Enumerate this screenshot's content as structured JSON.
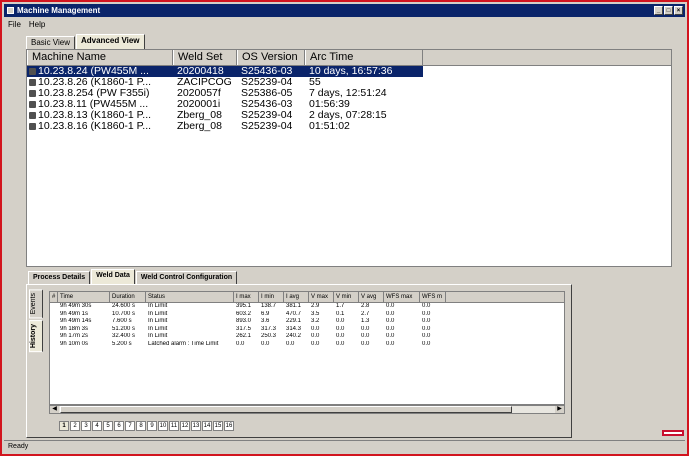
{
  "window": {
    "title": "Machine Management"
  },
  "menu": {
    "items": [
      "File",
      "Help"
    ]
  },
  "top_tabs": [
    {
      "label": "Basic View",
      "active": false
    },
    {
      "label": "Advanced View",
      "active": true
    }
  ],
  "machines": {
    "columns": [
      "Machine Name",
      "Weld Set",
      "OS Version",
      "Arc Time"
    ],
    "rows": [
      {
        "name": "10.23.8.24 (PW455M ...",
        "weld_set": "20200418",
        "os": "S25436-03",
        "arc": "10 days, 16:57:36",
        "selected": true
      },
      {
        "name": "10.23.8.26 (K1860-1 P...",
        "weld_set": "ZACIPCOG",
        "os": "S25239-04",
        "arc": "55",
        "selected": false
      },
      {
        "name": "10.23.8.254 (PW F355i)",
        "weld_set": "2020057f",
        "os": "S25386-05",
        "arc": "7 days, 12:51:24",
        "selected": false
      },
      {
        "name": "10.23.8.11 (PW455M ...",
        "weld_set": "2020001i",
        "os": "S25436-03",
        "arc": "01:56:39",
        "selected": false
      },
      {
        "name": "10.23.8.13 (K1860-1 P...",
        "weld_set": "Zberg_08",
        "os": "S25239-04",
        "arc": "2 days, 07:28:15",
        "selected": false
      },
      {
        "name": "10.23.8.16 (K1860-1 P...",
        "weld_set": "Zberg_08",
        "os": "S25239-04",
        "arc": "01:51:02",
        "selected": false
      }
    ]
  },
  "bottom_tabs": [
    {
      "label": "Process Details",
      "active": false
    },
    {
      "label": "Weld Data",
      "active": true
    },
    {
      "label": "Weld Control Configuration",
      "active": false
    }
  ],
  "side_tabs": [
    {
      "label": "Events",
      "active": false
    },
    {
      "label": "History",
      "active": true
    }
  ],
  "weld_data": {
    "columns": [
      "#",
      "Time",
      "Duration",
      "Status",
      "I max",
      "I min",
      "I avg",
      "V max",
      "V min",
      "V avg",
      "WFS max",
      "WFS m"
    ],
    "rows": [
      [
        "",
        "9h 49m 30s",
        "24.600 s",
        "In Limit",
        "395.1",
        "138.7",
        "381.1",
        "2.9",
        "1.7",
        "2.8",
        "0.0",
        "0.0"
      ],
      [
        "",
        "9h 49m 1s",
        "10.700 s",
        "In Limit",
        "603.2",
        "6.9",
        "470.7",
        "3.5",
        "0.1",
        "2.7",
        "0.0",
        "0.0"
      ],
      [
        "",
        "9h 49m 14s",
        "7.600 s",
        "In Limit",
        "893.0",
        "3.6",
        "229.1",
        "3.2",
        "0.0",
        "1.3",
        "0.0",
        "0.0"
      ],
      [
        "",
        "9h 18m 3s",
        "51.200 s",
        "In Limit",
        "317.5",
        "317.3",
        "314.3",
        "0.0",
        "0.0",
        "0.0",
        "0.0",
        "0.0"
      ],
      [
        "",
        "9h 17m 2s",
        "32.400 s",
        "In Limit",
        "262.1",
        "250.3",
        "240.2",
        "0.0",
        "0.0",
        "0.0",
        "0.0",
        "0.0"
      ],
      [
        "",
        "9h 10m 0s",
        "5.200 s",
        "Latched alarm : Time Limit",
        "0.0",
        "0.0",
        "0.0",
        "0.0",
        "0.0",
        "0.0",
        "0.0",
        "0.0"
      ]
    ]
  },
  "pager": {
    "pages": [
      "1",
      "2",
      "3",
      "4",
      "5",
      "6",
      "7",
      "8",
      "9",
      "10",
      "11",
      "12",
      "13",
      "14",
      "15",
      "16"
    ],
    "current": "1"
  },
  "status": {
    "text": "Ready"
  },
  "colors": {
    "selection": "#0a246a",
    "titlebar": "#0a246a",
    "frame": "#d2141e",
    "brand": "#c8102e"
  },
  "logo": {
    "label": "LINCOLN ELECTRIC"
  }
}
